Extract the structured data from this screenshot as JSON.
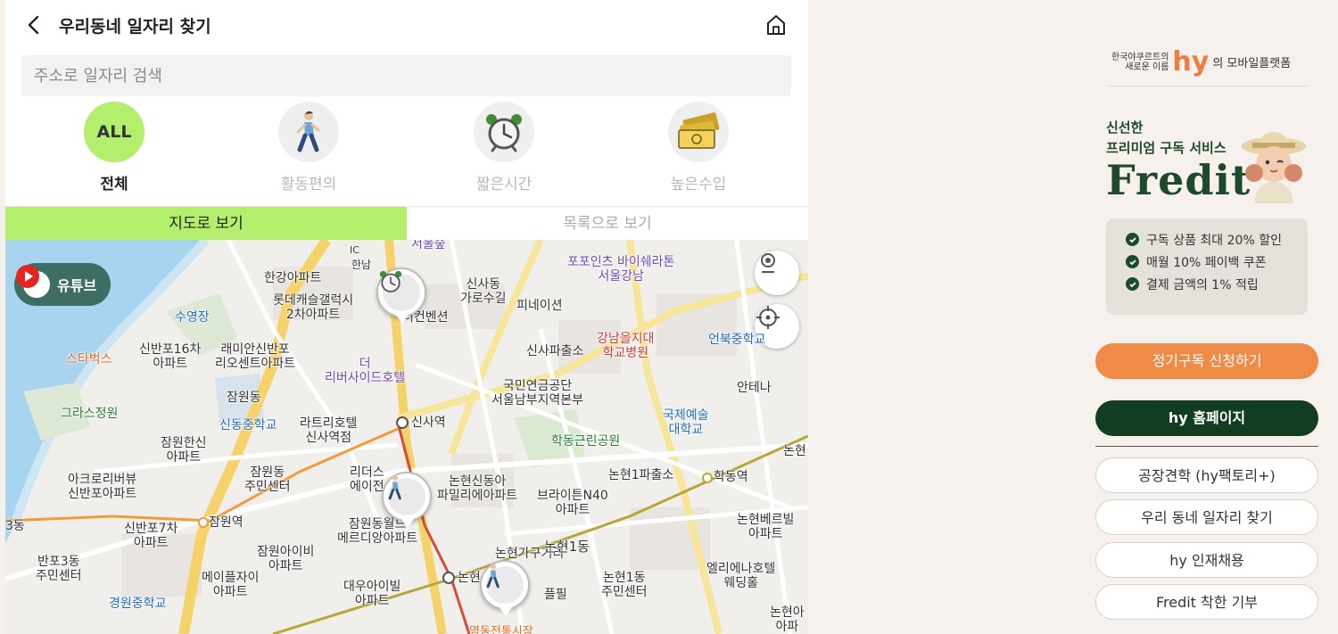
{
  "header": {
    "title": "우리동네 일자리 찾기"
  },
  "search": {
    "placeholder": "주소로 일자리 검색"
  },
  "categories": [
    {
      "label": "전체",
      "badge": "ALL",
      "active": true
    },
    {
      "label": "활동편의",
      "active": false
    },
    {
      "label": "짧은시간",
      "active": false
    },
    {
      "label": "높은수입",
      "active": false
    }
  ],
  "tabs": {
    "map": "지도로 보기",
    "list": "목록으로 보기"
  },
  "map": {
    "youtube_label": "유튜브",
    "places": [
      "서울숲",
      "한남",
      "IC",
      "한강아파트",
      "롯데캐슬갤럭시\n2차아파트",
      "수영장",
      "스타벅스",
      "신반포16차\n아파트",
      "래미안신반포\n리오센트아파트",
      "더\n리버사이드호텔",
      "더컨벤션",
      "신사동\n가로수길",
      "피네이션",
      "포포인츠 바이쉐라톤\n서울강남",
      "강남을지대\n학교병원",
      "언북중학교",
      "신사파출소",
      "국민연금공단\n서울남부지역본부",
      "안테나",
      "잠원동",
      "신동중학교",
      "그라스정원",
      "라트리호텔\n신사역점",
      "신사역",
      "국제예술\n대학교",
      "학동근린공원",
      "잠원한신\n아파트",
      "잠원동\n주민센터",
      "아크로리버뷰\n신반포아파트",
      "리더스\n에이전",
      "논현신동아\n파밀리에아파트",
      "논현1파출소",
      "학동역",
      "브라이튼N40\n아파트",
      "잠원역",
      "신반포7차\n아파트",
      "잠원동월드\n메르디앙아파트",
      "논현가구거리",
      "논현1동",
      "논현베르빌\n아파트",
      "반포3동\n주민센터",
      "잠원아이비\n아파트",
      "메이플자이\n아파트",
      "대우아이빌\n아파트",
      "논현",
      "플필",
      "논현1동\n주민센터",
      "엘리에나호텔\n웨딩홀",
      "경원중학교",
      "영동전통시장",
      "논현아\n아파",
      "3동",
      "논현"
    ]
  },
  "sidebar": {
    "brand_prefix": "한국야쿠르트의\n새로운 이름",
    "brand_logo": "hy",
    "brand_suffix": "의 모바일플랫폼",
    "promo_line1": "신선한",
    "promo_line2": "프리미엄 구독 서비스",
    "promo_brand": "Fredit",
    "benefits": [
      "구독 상품 최대 20% 할인",
      "매월 10% 페이백 쿠폰",
      "결제 금액의 1% 적립"
    ],
    "subscribe_button": "정기구독 신청하기",
    "homepage_button": "hy 홈페이지",
    "links": [
      "공장견학 (hy팩토리+)",
      "우리 동네 일자리 찾기",
      "hy 인재채용",
      "Fredit 착한 기부"
    ]
  },
  "colors": {
    "accent_green": "#b3ee6d",
    "orange": "#ef8a47",
    "dark_green": "#113d22"
  }
}
